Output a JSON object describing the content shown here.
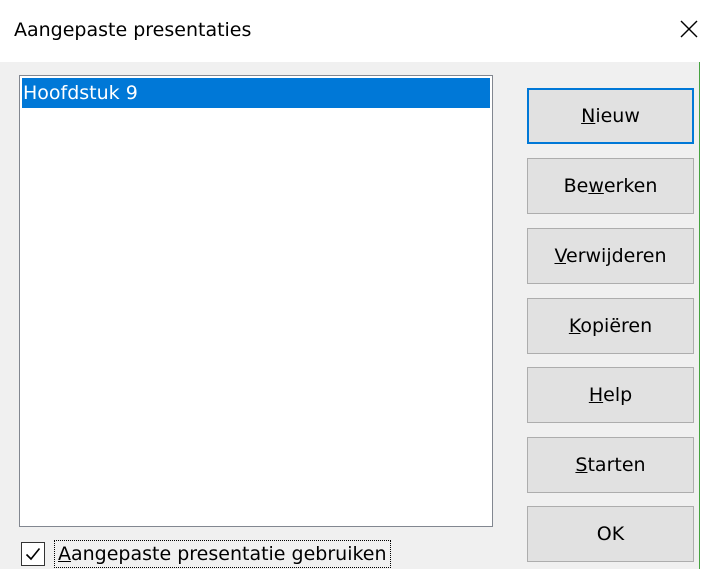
{
  "window": {
    "title": "Aangepaste presentaties",
    "close_icon": "close-icon",
    "accent_color": "#0078d7"
  },
  "list": {
    "items": [
      {
        "label": "Hoofdstuk 9",
        "selected": true
      }
    ]
  },
  "buttons": {
    "new": {
      "pre": "",
      "mnemonic": "N",
      "post": "ieuw"
    },
    "edit": {
      "pre": "Be",
      "mnemonic": "w",
      "post": "erken"
    },
    "delete": {
      "pre": "",
      "mnemonic": "V",
      "post": "erwijderen"
    },
    "copy": {
      "pre": "",
      "mnemonic": "K",
      "post": "opiëren"
    },
    "help": {
      "pre": "",
      "mnemonic": "H",
      "post": "elp"
    },
    "start": {
      "pre": "",
      "mnemonic": "S",
      "post": "tarten"
    },
    "ok": {
      "label": "OK"
    }
  },
  "checkbox": {
    "checked": true,
    "mnemonic": "A",
    "label_rest": "angepaste presentatie gebruiken"
  }
}
